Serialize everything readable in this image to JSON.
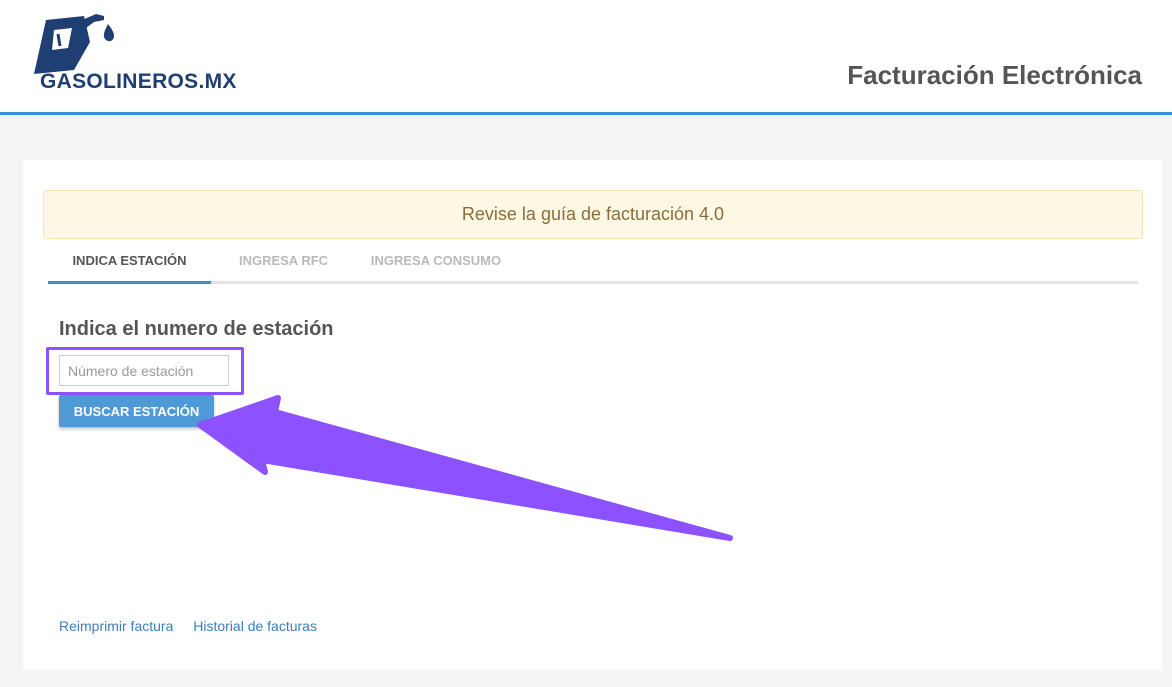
{
  "brand": {
    "name": "GASOLINEROS.MX",
    "colors": {
      "primary": "#1f3f73",
      "drop": "#1f3f73"
    }
  },
  "header": {
    "title": "Facturación Electrónica",
    "accent_color": "#3f8fd0"
  },
  "alert": {
    "text": "Revise la guía de facturación 4.0",
    "colors": {
      "background": "#fcf8e3",
      "text": "#8a6d3b"
    }
  },
  "tabs": [
    {
      "label": "INDICA ESTACIÓN",
      "active": true
    },
    {
      "label": "INGRESA RFC",
      "active": false
    },
    {
      "label": "INGRESA CONSUMO",
      "active": false
    }
  ],
  "step": {
    "title": "Indica el numero de estación",
    "input": {
      "value": "",
      "placeholder": "Número de estación"
    },
    "button_label": "BUSCAR ESTACIÓN"
  },
  "footer": {
    "links": [
      "Reimprimir factura",
      "Historial de facturas"
    ]
  },
  "annotation": {
    "highlight_color": "#8c52ff",
    "arrow_icon": "arrow-pointer-icon"
  }
}
